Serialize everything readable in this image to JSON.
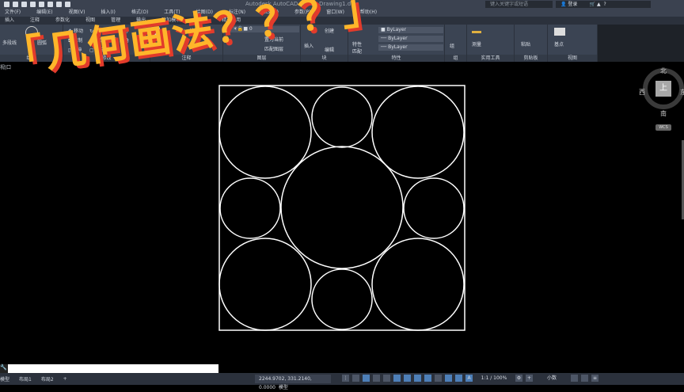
{
  "window": {
    "title": "Autodesk AutoCAD 2020",
    "doc": "Drawing1.dwg",
    "search_placeholder": "键入关键字或短语",
    "login": "登录"
  },
  "menu": [
    "文件(F)",
    "编辑(E)",
    "视图(V)",
    "插入(I)",
    "格式(O)",
    "工具(T)",
    "绘图(D)",
    "标注(N)",
    "修改(M)",
    "参数(P)",
    "窗口(W)",
    "帮助(H)"
  ],
  "ribbon_tabs": [
    "插入",
    "注释",
    "参数化",
    "视图",
    "管理",
    "输出",
    "附加模块",
    "协作",
    "精选应用"
  ],
  "ribbon": {
    "draw": {
      "title": "绘图",
      "polyline": "多段线",
      "circle": "圆",
      "arc": "圆弧"
    },
    "modify": {
      "title": "修改",
      "move": "移动",
      "rotate": "旋转",
      "trim": "修剪",
      "copy": "复制",
      "mirror": "镜像",
      "fillet": "圆角",
      "stretch": "拉伸",
      "scale": "缩放"
    },
    "annotation": {
      "title": "注释",
      "linear": "线性",
      "text": "文字"
    },
    "layers": {
      "title": "图层",
      "layer_value": "0",
      "make_current": "置为当前",
      "match": "匹配图层"
    },
    "block": {
      "title": "块",
      "insert": "插入",
      "create": "创建",
      "edit": "编辑"
    },
    "properties": {
      "title": "特性",
      "match": "特性匹配",
      "color": "ByLayer",
      "linetype": "ByLayer",
      "lineweight": "ByLayer"
    },
    "groups": {
      "title": "组",
      "group": "组"
    },
    "utilities": {
      "title": "实用工具",
      "measure": "测量"
    },
    "clipboard": {
      "title": "剪贴板",
      "paste": "粘贴"
    },
    "view": {
      "title": "视图",
      "base": "基点"
    }
  },
  "viewport_label": "视|口",
  "overlay_title": "「几何画法？？？」",
  "viewcube": {
    "north": "北",
    "south": "南",
    "west": "西",
    "east": "东",
    "top": "上",
    "wcs": "WCS"
  },
  "command_line": {
    "value": ""
  },
  "status": {
    "model": "模型",
    "layout1": "布局1",
    "layout2": "布局2",
    "add": "+",
    "coords": "2244.9702, 331.2140, 0.0000",
    "model_btn": "模型",
    "scale": "1:1 / 100%",
    "units": "小数"
  },
  "colors": {
    "ribbon": "#3b4453",
    "overlay_fill": "#ffb62a",
    "overlay_shadow": "#e23b2b",
    "drawing_lines": "#ffffff"
  }
}
